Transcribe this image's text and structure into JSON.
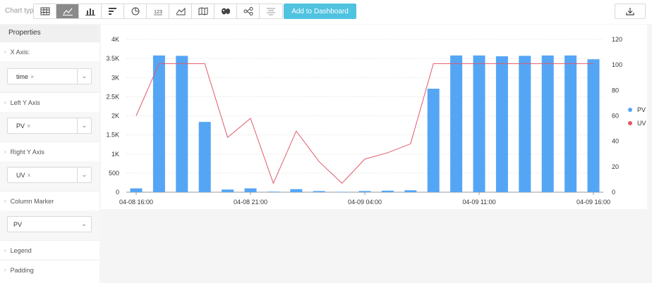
{
  "toolbar": {
    "chart_type_label": "Chart type",
    "buttons": [
      {
        "name": "table",
        "icon": "table-icon"
      },
      {
        "name": "line",
        "icon": "line-chart-icon",
        "active": true
      },
      {
        "name": "bar",
        "icon": "bar-chart-icon"
      },
      {
        "name": "horizontal-bar",
        "icon": "horizontal-bar-icon"
      },
      {
        "name": "pie",
        "icon": "pie-chart-icon"
      },
      {
        "name": "number",
        "icon": "number-icon",
        "text": "123"
      },
      {
        "name": "area",
        "icon": "area-chart-icon"
      },
      {
        "name": "map",
        "icon": "map-icon"
      },
      {
        "name": "world-map",
        "icon": "world-map-icon"
      },
      {
        "name": "flow",
        "icon": "flow-icon"
      },
      {
        "name": "funnel",
        "icon": "funnel-icon"
      }
    ],
    "add_to_dashboard_label": "Add to Dashboard",
    "download_icon": "download-icon"
  },
  "sidebar": {
    "header": "Properties",
    "x_axis": {
      "label": "X Axis:",
      "tag": "time",
      "remove": "×"
    },
    "left_y_axis": {
      "label": "Left Y Axis",
      "tag": "PV",
      "remove": "×"
    },
    "right_y_axis": {
      "label": "Right Y Axis",
      "tag": "UV",
      "remove": "×"
    },
    "column_marker": {
      "label": "Column Marker",
      "value": "PV"
    },
    "legend": {
      "label": "Legend"
    },
    "padding": {
      "label": "Padding"
    }
  },
  "colors": {
    "bar": "#55a5f5",
    "line": "#e05a6a",
    "accent": "#4fc3e0"
  },
  "chart_data": {
    "type": "bar",
    "x_ticks": [
      "04-08 16:00",
      "04-08 21:00",
      "04-09 04:00",
      "04-09 11:00",
      "04-09 16:00"
    ],
    "left_axis": {
      "ticks": [
        "0",
        "500",
        "1K",
        "1.5K",
        "2K",
        "2.5K",
        "3K",
        "3.5K",
        "4K"
      ],
      "ylim": [
        0,
        4000
      ]
    },
    "right_axis": {
      "ticks": [
        "0",
        "20",
        "40",
        "60",
        "80",
        "100",
        "120"
      ],
      "ylim": [
        0,
        120
      ]
    },
    "legend": [
      "PV",
      "UV"
    ],
    "series": [
      {
        "name": "PV",
        "axis": "left",
        "type": "bar",
        "values": [
          100,
          3580,
          3570,
          1840,
          70,
          100,
          15,
          80,
          30,
          10,
          30,
          40,
          50,
          2710,
          3580,
          3580,
          3560,
          3570,
          3580,
          3580,
          3480
        ]
      },
      {
        "name": "UV",
        "axis": "right",
        "type": "line",
        "values": [
          60,
          101,
          101,
          101,
          43,
          58,
          7,
          48,
          24,
          7,
          26,
          31,
          38,
          101,
          101,
          101,
          101,
          101,
          101,
          101,
          101
        ]
      }
    ]
  }
}
